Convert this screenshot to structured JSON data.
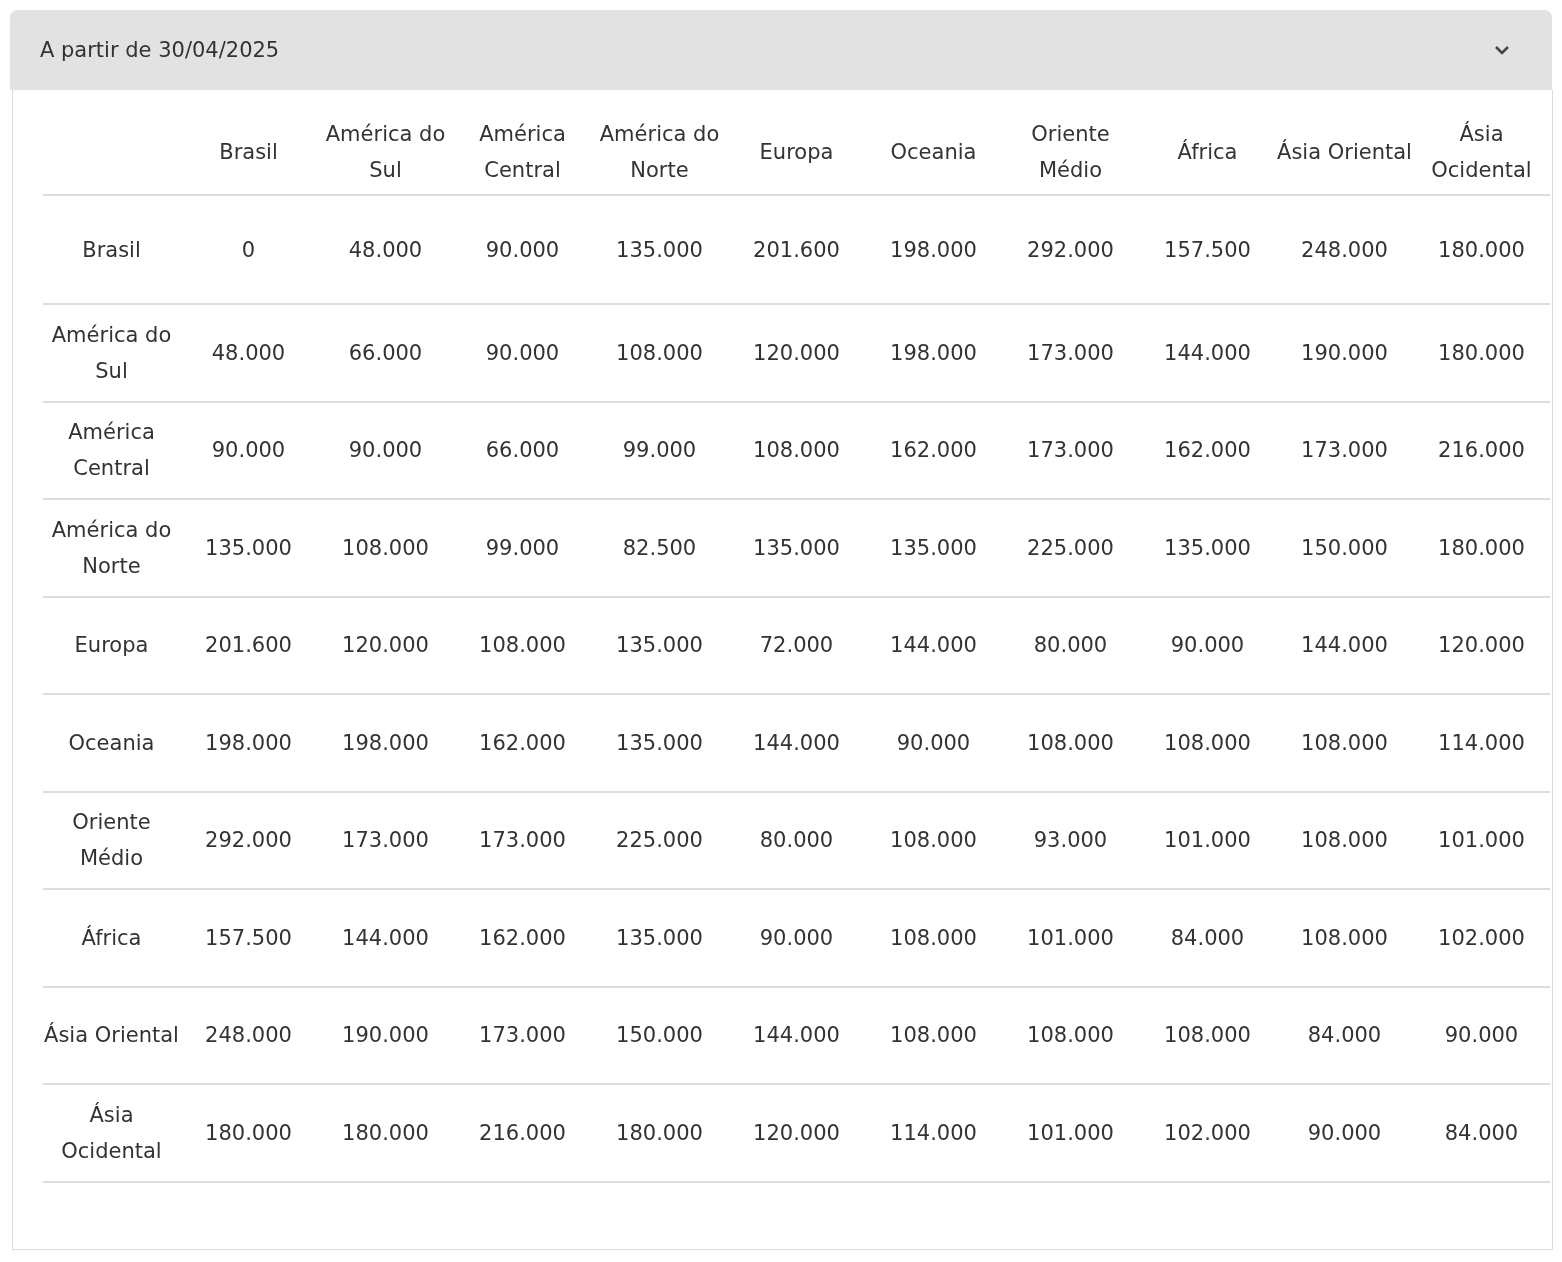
{
  "accordion": {
    "title": "A partir de 30/04/2025",
    "expanded": true
  },
  "table": {
    "columns": [
      "Brasil",
      "América do Sul",
      "América Central",
      "América do Norte",
      "Europa",
      "Oceania",
      "Oriente Médio",
      "África",
      "Ásia Oriental",
      "Ásia Ocidental"
    ],
    "rows": [
      {
        "label": "Brasil",
        "cells": [
          "0",
          "48.000",
          "90.000",
          "135.000",
          "201.600",
          "198.000",
          "292.000",
          "157.500",
          "248.000",
          "180.000"
        ]
      },
      {
        "label": "América do Sul",
        "cells": [
          "48.000",
          "66.000",
          "90.000",
          "108.000",
          "120.000",
          "198.000",
          "173.000",
          "144.000",
          "190.000",
          "180.000"
        ]
      },
      {
        "label": "América Central",
        "cells": [
          "90.000",
          "90.000",
          "66.000",
          "99.000",
          "108.000",
          "162.000",
          "173.000",
          "162.000",
          "173.000",
          "216.000"
        ]
      },
      {
        "label": "América do Norte",
        "cells": [
          "135.000",
          "108.000",
          "99.000",
          "82.500",
          "135.000",
          "135.000",
          "225.000",
          "135.000",
          "150.000",
          "180.000"
        ]
      },
      {
        "label": "Europa",
        "cells": [
          "201.600",
          "120.000",
          "108.000",
          "135.000",
          "72.000",
          "144.000",
          "80.000",
          "90.000",
          "144.000",
          "120.000"
        ]
      },
      {
        "label": "Oceania",
        "cells": [
          "198.000",
          "198.000",
          "162.000",
          "135.000",
          "144.000",
          "90.000",
          "108.000",
          "108.000",
          "108.000",
          "114.000"
        ]
      },
      {
        "label": "Oriente Médio",
        "cells": [
          "292.000",
          "173.000",
          "173.000",
          "225.000",
          "80.000",
          "108.000",
          "93.000",
          "101.000",
          "108.000",
          "101.000"
        ]
      },
      {
        "label": "África",
        "cells": [
          "157.500",
          "144.000",
          "162.000",
          "135.000",
          "90.000",
          "108.000",
          "101.000",
          "84.000",
          "108.000",
          "102.000"
        ]
      },
      {
        "label": "Ásia Oriental",
        "cells": [
          "248.000",
          "190.000",
          "173.000",
          "150.000",
          "144.000",
          "108.000",
          "108.000",
          "108.000",
          "84.000",
          "90.000"
        ]
      },
      {
        "label": "Ásia Ocidental",
        "cells": [
          "180.000",
          "180.000",
          "216.000",
          "180.000",
          "120.000",
          "114.000",
          "101.000",
          "102.000",
          "90.000",
          "84.000"
        ]
      }
    ]
  }
}
